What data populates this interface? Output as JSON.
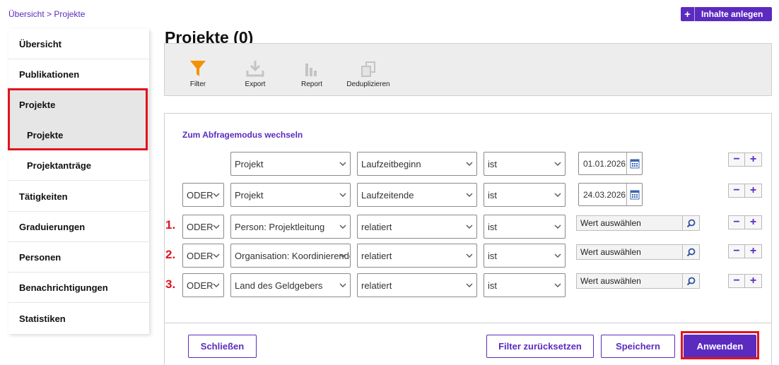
{
  "breadcrumb": {
    "root": "Übersicht",
    "separator": ">",
    "current": "Projekte"
  },
  "header": {
    "create_button": "Inhalte anlegen",
    "create_icon": "plus-icon"
  },
  "page": {
    "title": "Projekte (0)"
  },
  "sidebar": {
    "items": [
      {
        "label": "Übersicht"
      },
      {
        "label": "Publikationen"
      },
      {
        "label": "Projekte"
      },
      {
        "label": "Projekte"
      },
      {
        "label": "Projektanträge"
      },
      {
        "label": "Tätigkeiten"
      },
      {
        "label": "Graduierungen"
      },
      {
        "label": "Personen"
      },
      {
        "label": "Benachrichtigungen"
      },
      {
        "label": "Statistiken"
      }
    ]
  },
  "toolbar": {
    "filter": "Filter",
    "export": "Export",
    "report": "Report",
    "dedupe": "Deduplizieren"
  },
  "filters": {
    "mode_link": "Zum Abfragemodus wechseln",
    "rows": [
      {
        "conj": "",
        "field": "Projekt",
        "attribute": "Laufzeitbeginn",
        "operator": "ist",
        "value": "01.01.2026",
        "number": ""
      },
      {
        "conj": "ODER",
        "field": "Projekt",
        "attribute": "Laufzeitende",
        "operator": "ist",
        "value": "24.03.2026",
        "number": ""
      },
      {
        "conj": "ODER",
        "field": "Person: Projektleitung",
        "attribute": "relatiert",
        "operator": "ist",
        "value": "Wert auswählen",
        "number": "1."
      },
      {
        "conj": "ODER",
        "field": "Organisation: Koordinierende",
        "attribute": "relatiert",
        "operator": "ist",
        "value": "Wert auswählen",
        "number": "2."
      },
      {
        "conj": "ODER",
        "field": "Land des Geldgebers",
        "attribute": "relatiert",
        "operator": "ist",
        "value": "Wert auswählen",
        "number": "3."
      }
    ],
    "minus": "−",
    "plus": "+"
  },
  "footer": {
    "close": "Schließen",
    "reset": "Filter zurücksetzen",
    "save": "Speichern",
    "apply": "Anwenden"
  },
  "colors": {
    "accent": "#5b2bc0",
    "highlight": "#e0141e",
    "filter_icon": "#f39200"
  }
}
